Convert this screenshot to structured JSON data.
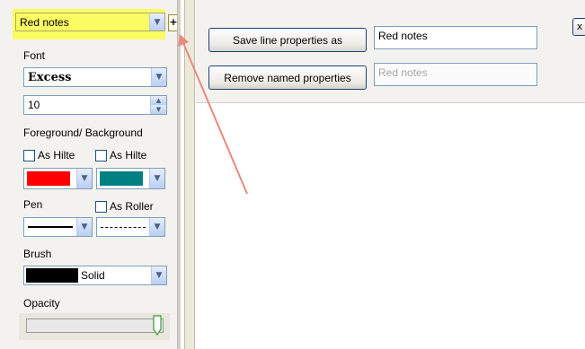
{
  "style_preset": {
    "value": "Red notes",
    "add_label": "+"
  },
  "font_section": {
    "label": "Font",
    "font_name": "Excess",
    "font_size": "10"
  },
  "color_section": {
    "label": "Foreground/ Background",
    "fg_as_hilite": "As Hilte",
    "bg_as_hilite": "As Hilte",
    "fg_color": "#ff0000",
    "bg_color": "#008080"
  },
  "pen_section": {
    "label": "Pen",
    "as_roller": "As Roller",
    "pen_style_1": "solid-line",
    "pen_style_2": "dashed-line"
  },
  "brush_section": {
    "label": "Brush",
    "brush_color": "#000000",
    "brush_style": "Solid"
  },
  "opacity_section": {
    "label": "Opacity",
    "level": 1.0
  },
  "toolbar": {
    "save_button": "Save line properties as",
    "save_name_value": "Red notes",
    "remove_button": "Remove named properties",
    "remove_name_placeholder": "Red notes",
    "close_label": "x"
  }
}
